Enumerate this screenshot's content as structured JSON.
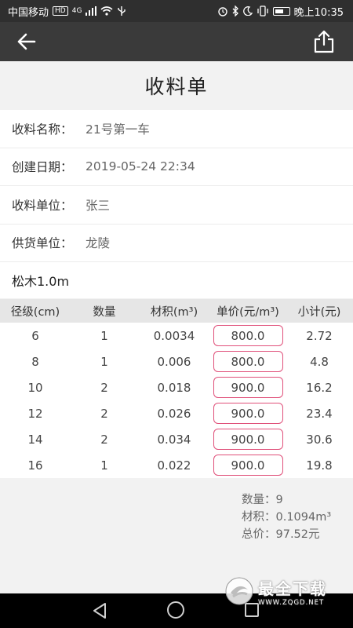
{
  "status_bar": {
    "carrier": "中国移动",
    "hd_badge": "HD",
    "network": "4G",
    "time": "晚上10:35",
    "icons": [
      "hd-icon",
      "signal-icon",
      "wifi-icon",
      "usb-icon",
      "alarm-icon",
      "bluetooth-icon",
      "moon-icon",
      "vibrate-icon",
      "battery-icon"
    ]
  },
  "app_bar": {
    "back_icon": "arrow-left-icon",
    "share_icon": "share-icon"
  },
  "page": {
    "title": "收料单"
  },
  "info": {
    "rows": [
      {
        "label": "收料名称：",
        "value": "21号第一车"
      },
      {
        "label": "创建日期：",
        "value": "2019-05-24 22:34"
      },
      {
        "label": "收料单位：",
        "value": "张三"
      },
      {
        "label": "供货单位：",
        "value": "龙陵"
      }
    ],
    "wood_type": "松木1.0m"
  },
  "table": {
    "headers": [
      "径级(cm)",
      "数量",
      "材积(m³)",
      "单价(元/m³)",
      "小计(元)"
    ],
    "rows": [
      {
        "diameter": "6",
        "qty": "1",
        "volume": "0.0034",
        "price": "800.0",
        "subtotal": "2.72"
      },
      {
        "diameter": "8",
        "qty": "1",
        "volume": "0.006",
        "price": "800.0",
        "subtotal": "4.8"
      },
      {
        "diameter": "10",
        "qty": "2",
        "volume": "0.018",
        "price": "900.0",
        "subtotal": "16.2"
      },
      {
        "diameter": "12",
        "qty": "2",
        "volume": "0.026",
        "price": "900.0",
        "subtotal": "23.4"
      },
      {
        "diameter": "14",
        "qty": "2",
        "volume": "0.034",
        "price": "900.0",
        "subtotal": "30.6"
      },
      {
        "diameter": "16",
        "qty": "1",
        "volume": "0.022",
        "price": "900.0",
        "subtotal": "19.8"
      }
    ]
  },
  "summary": {
    "quantity": "数量：9",
    "volume": "材积：0.1094m³",
    "total": "总价：97.52元"
  },
  "watermark": {
    "name": "最全下载",
    "url": "WWW.ZQGD.NET"
  },
  "colors": {
    "status_bar_bg": "#2f2f2f",
    "app_bar_bg": "#3a3a3a",
    "price_border": "#e0507a",
    "page_bg": "#f2f2f2"
  }
}
